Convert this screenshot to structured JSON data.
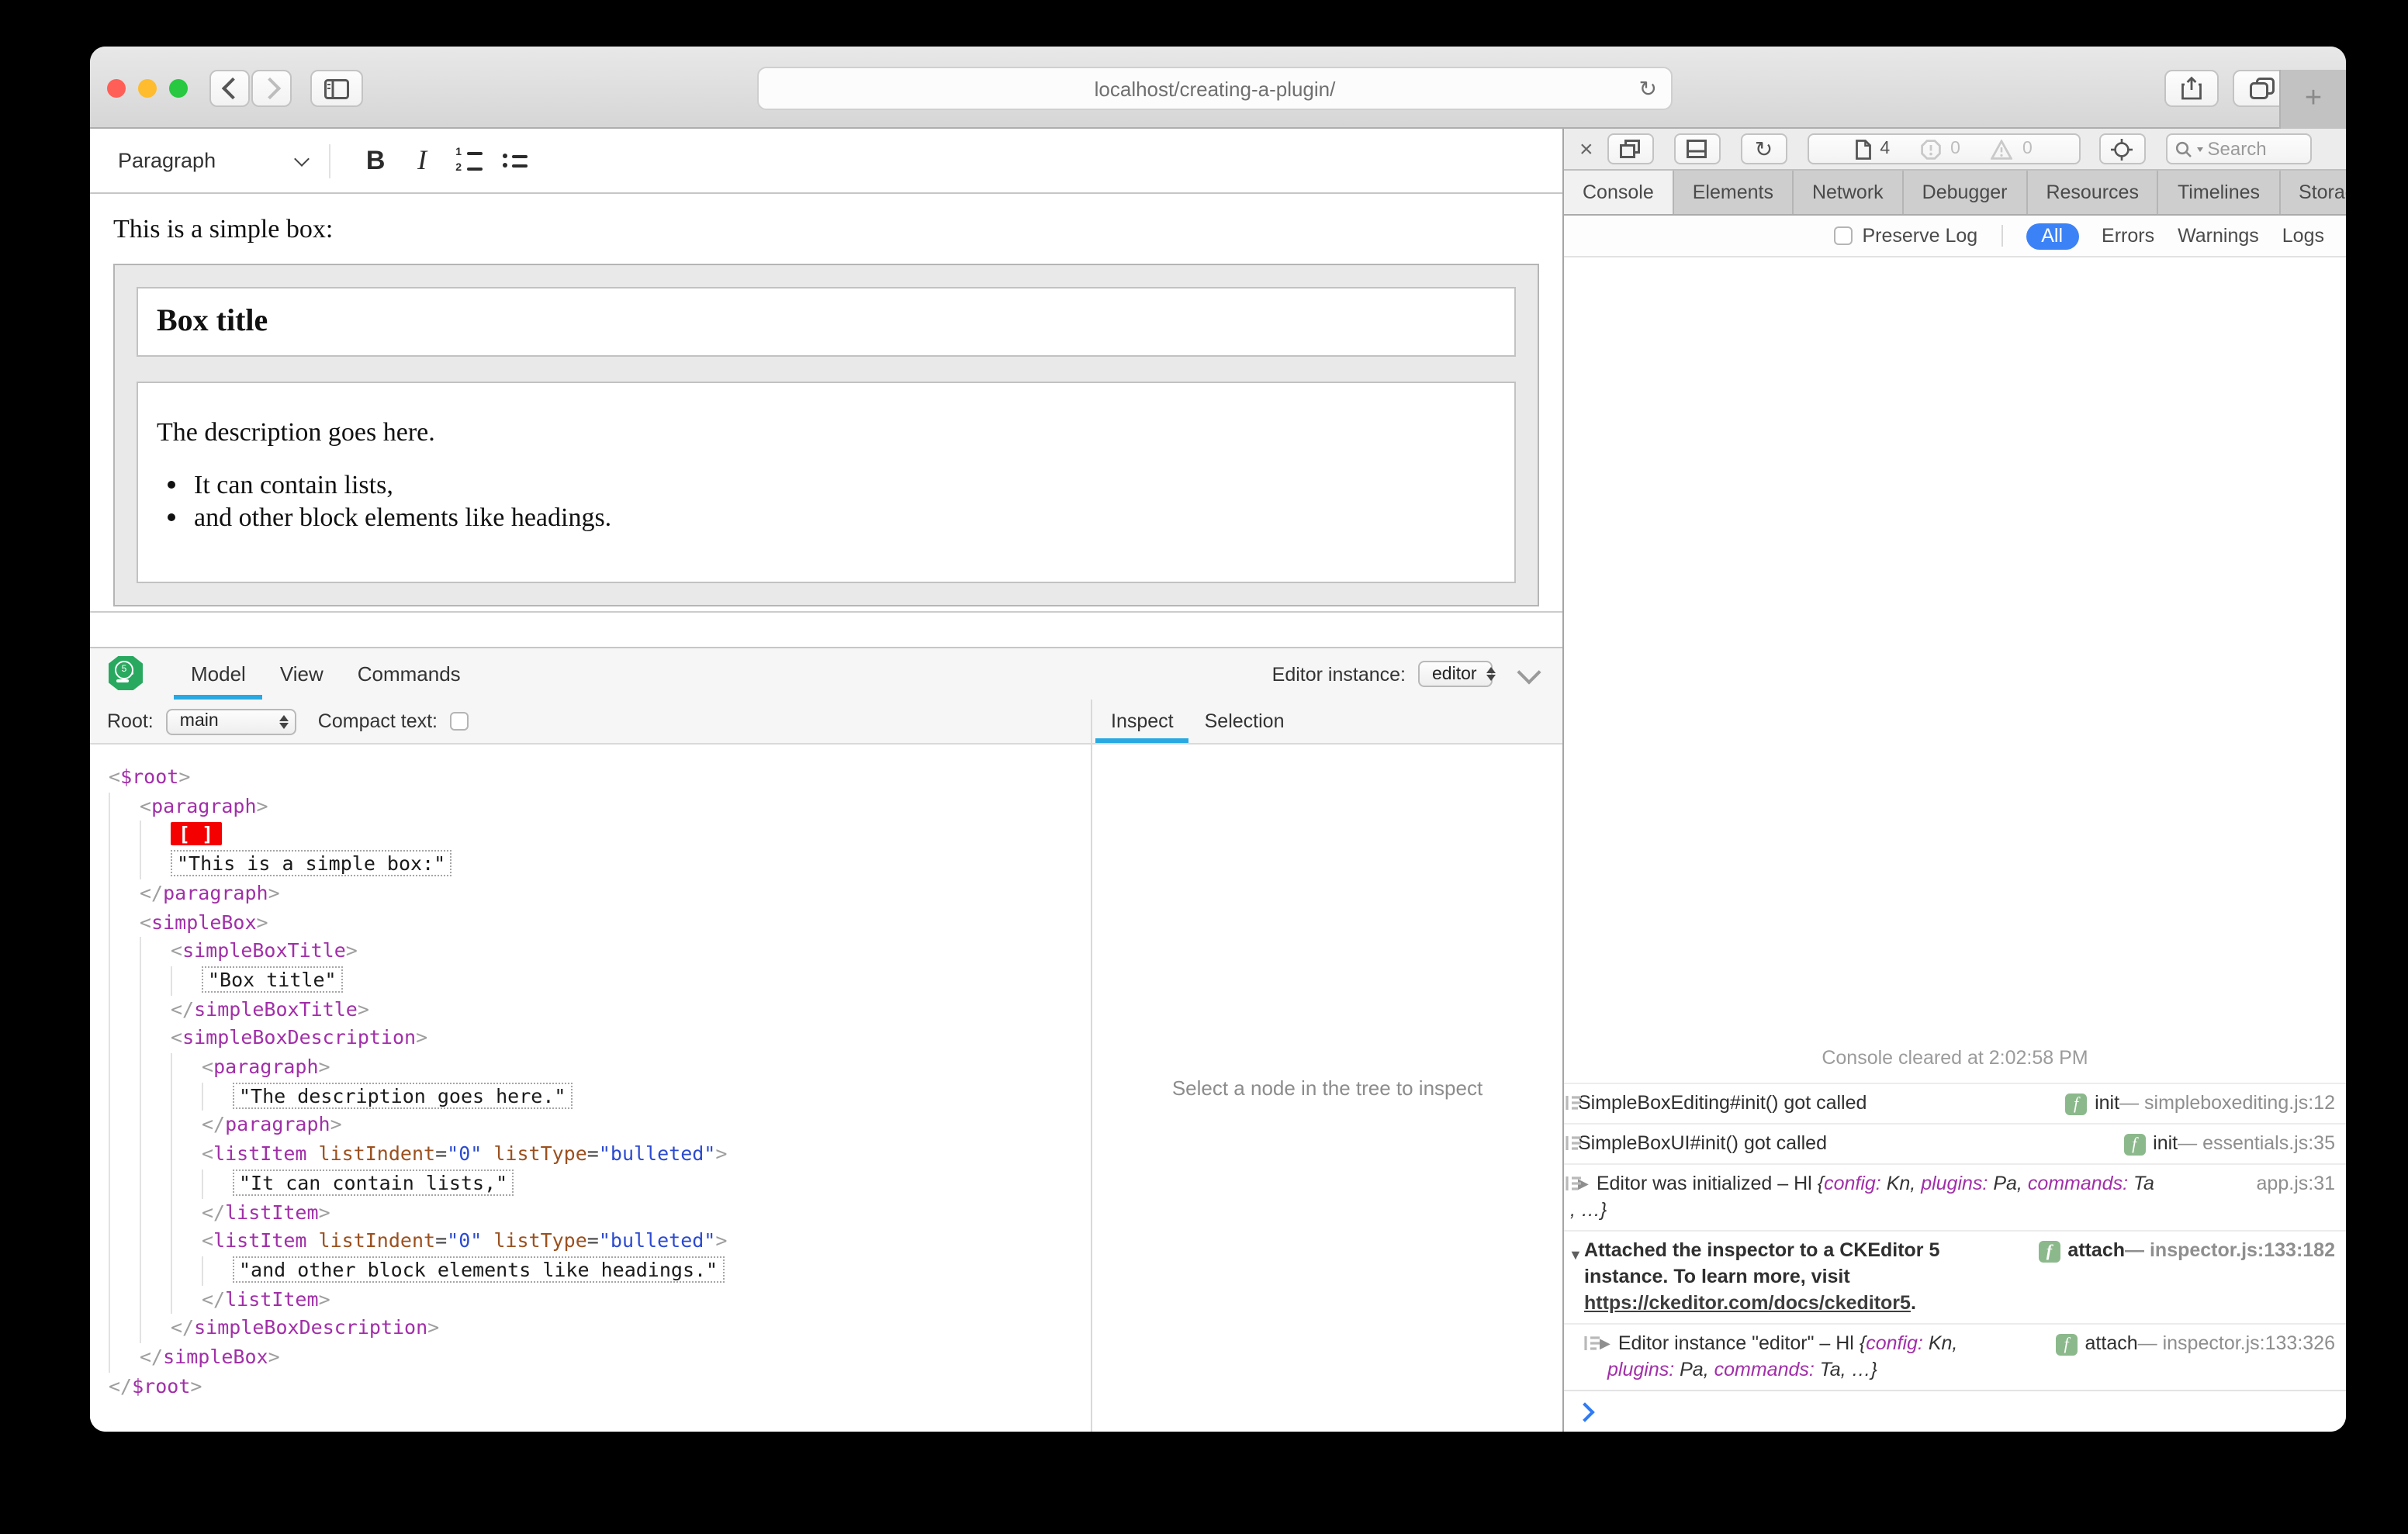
{
  "browser": {
    "url": "localhost/creating-a-plugin/",
    "new_tab_glyph": "+"
  },
  "editor": {
    "toolbar": {
      "paragraph": "Paragraph",
      "bold": "B",
      "italic": "I",
      "numbered_list_nums": [
        "1",
        "2"
      ]
    },
    "content": {
      "intro": "This is a simple box:",
      "title": "Box title",
      "description": "The description goes here.",
      "list": [
        "It can contain lists,",
        "and other block elements like headings."
      ]
    }
  },
  "inspector": {
    "logo_badge": "5",
    "tabs": [
      "Model",
      "View",
      "Commands"
    ],
    "active_tab": "Model",
    "editor_instance_label": "Editor instance:",
    "editor_instance": "editor",
    "root_label": "Root:",
    "root": "main",
    "compact_text_label": "Compact text:",
    "pane_tabs": [
      "Inspect",
      "Selection"
    ],
    "active_pane_tab": "Inspect",
    "empty_message": "Select a node in the tree to inspect",
    "selection_marker": "[ ]",
    "tree": [
      {
        "i": 0,
        "t": "open",
        "n": "$root"
      },
      {
        "i": 1,
        "t": "open",
        "n": "paragraph"
      },
      {
        "i": 2,
        "t": "sel"
      },
      {
        "i": 2,
        "t": "text",
        "s": "This is a simple box:"
      },
      {
        "i": 1,
        "t": "close",
        "n": "paragraph"
      },
      {
        "i": 1,
        "t": "open",
        "n": "simpleBox"
      },
      {
        "i": 2,
        "t": "open",
        "n": "simpleBoxTitle"
      },
      {
        "i": 3,
        "t": "text",
        "s": "Box title"
      },
      {
        "i": 2,
        "t": "close",
        "n": "simpleBoxTitle"
      },
      {
        "i": 2,
        "t": "open",
        "n": "simpleBoxDescription"
      },
      {
        "i": 3,
        "t": "open",
        "n": "paragraph"
      },
      {
        "i": 4,
        "t": "text",
        "s": "The description goes here."
      },
      {
        "i": 3,
        "t": "close",
        "n": "paragraph"
      },
      {
        "i": 3,
        "t": "open",
        "n": "listItem",
        "a": [
          [
            "listIndent",
            "0"
          ],
          [
            "listType",
            "bulleted"
          ]
        ]
      },
      {
        "i": 4,
        "t": "text",
        "s": "It can contain lists,"
      },
      {
        "i": 3,
        "t": "close",
        "n": "listItem"
      },
      {
        "i": 3,
        "t": "open",
        "n": "listItem",
        "a": [
          [
            "listIndent",
            "0"
          ],
          [
            "listType",
            "bulleted"
          ]
        ]
      },
      {
        "i": 4,
        "t": "text",
        "s": "and other block elements like headings."
      },
      {
        "i": 3,
        "t": "close",
        "n": "listItem"
      },
      {
        "i": 2,
        "t": "close",
        "n": "simpleBoxDescription"
      },
      {
        "i": 1,
        "t": "close",
        "n": "simpleBox"
      },
      {
        "i": 0,
        "t": "close",
        "n": "$root"
      }
    ]
  },
  "devtools": {
    "tabs": [
      "Console",
      "Elements",
      "Network",
      "Debugger",
      "Resources",
      "Timelines",
      "Storage"
    ],
    "active_tab": "Console",
    "more_tabs_glyph": "»",
    "add_tab_glyph": "+",
    "gear_glyph": "⚙",
    "page_count": "4",
    "error_count": "0",
    "warning_count": "0",
    "search_placeholder": "Search",
    "filters": {
      "preserve_log": "Preserve Log",
      "options": [
        "All",
        "Errors",
        "Warnings",
        "Logs"
      ],
      "active": "All"
    },
    "console_cleared": "Console cleared at 2:02:58 PM",
    "rows": [
      {
        "icon": true,
        "lines": [
          [
            {
              "t": "SimpleBoxEditing#init() got called",
              "s": "p"
            }
          ]
        ],
        "fn": "init",
        "loc": "simpleboxediting.js:12"
      },
      {
        "icon": true,
        "lines": [
          [
            {
              "t": "SimpleBoxUI#init() got called",
              "s": "p"
            }
          ]
        ],
        "fn": "init",
        "loc": "essentials.js:35"
      },
      {
        "icon": true,
        "disc": "right",
        "l2": "flush",
        "lines": [
          [
            {
              "t": "Editor was initialized – Hl ",
              "s": "p"
            },
            {
              "t": "{",
              "s": "v"
            },
            {
              "t": "config:",
              "s": "o"
            },
            {
              "t": " Kn, ",
              "s": "v"
            },
            {
              "t": "plugins:",
              "s": "o"
            },
            {
              "t": " Pa, ",
              "s": "v"
            },
            {
              "t": "commands:",
              "s": "o"
            },
            {
              "t": " Ta",
              "s": "v"
            }
          ],
          [
            {
              "t": ", …}",
              "s": "v"
            }
          ]
        ],
        "fn": null,
        "loc": "app.js:31"
      },
      {
        "icon": false,
        "disc": "down",
        "cls": "attached",
        "lines": [
          [
            {
              "t": "Attached the inspector to a CKEditor 5",
              "s": "b"
            }
          ],
          [
            {
              "t": "instance. To learn more, visit",
              "s": "b"
            }
          ],
          [
            {
              "t": "https://ckeditor.com/docs/ckeditor5",
              "s": "l"
            },
            {
              "t": ".",
              "s": "b"
            }
          ]
        ],
        "fn": "attach",
        "loc": "inspector.js:133:182"
      },
      {
        "icon": true,
        "disc": "right",
        "cls": "nested",
        "lines": [
          [
            {
              "t": "Editor instance \"editor\" – Hl ",
              "s": "p"
            },
            {
              "t": "{",
              "s": "v"
            },
            {
              "t": "config:",
              "s": "o"
            },
            {
              "t": " Kn,",
              "s": "v"
            }
          ],
          [
            {
              "t": "plugins:",
              "s": "o"
            },
            {
              "t": " Pa, ",
              "s": "v"
            },
            {
              "t": "commands:",
              "s": "o"
            },
            {
              "t": " Ta, …}",
              "s": "v"
            }
          ]
        ],
        "fn": "attach",
        "loc": "inspector.js:133:326"
      }
    ]
  },
  "colors": {
    "accent_inspector_blue": "#29a9e2",
    "devtools_filter_blue": "#3c82f7",
    "tag_purple": "#a12fa8",
    "attr_name_brown": "#9b501f",
    "attr_value_blue": "#2b4ad0",
    "selection_red": "#f50000",
    "function_badge_green": "#8cb98c",
    "ckeditor_green": "#28a95f",
    "traffic_red": "#ff5f57",
    "traffic_yellow": "#febc2e",
    "traffic_green": "#28c840"
  }
}
